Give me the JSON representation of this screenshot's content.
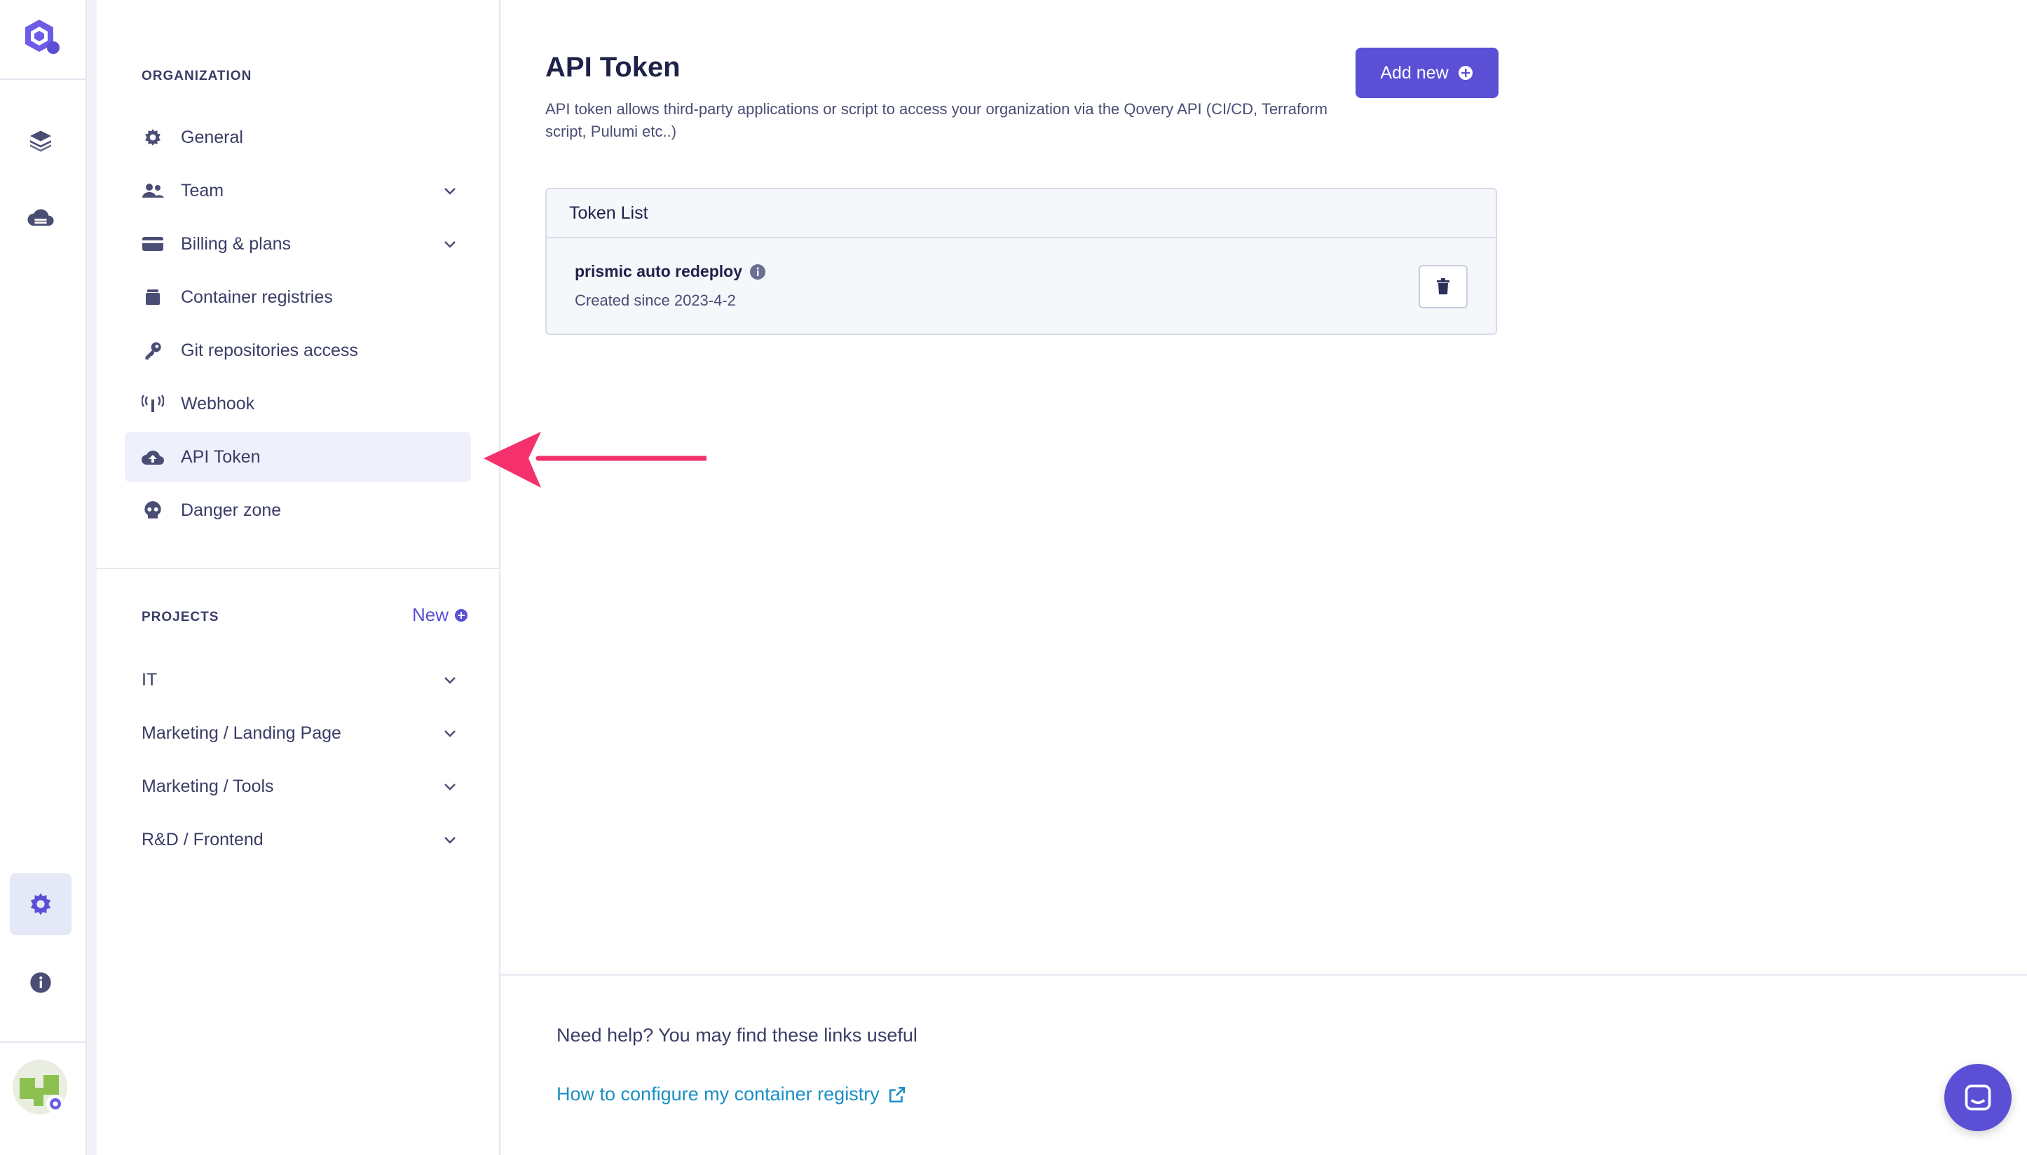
{
  "colors": {
    "accent": "#5b4fd6",
    "link": "#1a8fc4",
    "annotation_arrow": "#f4306d"
  },
  "rail": {
    "icons": [
      "qovery-logo-icon",
      "layers-icon",
      "cloud-server-icon",
      "settings-gear-icon",
      "info-icon"
    ],
    "active": "settings-gear-icon"
  },
  "sidebar": {
    "organization_title": "ORGANIZATION",
    "items": [
      {
        "label": "General",
        "icon": "gear-icon"
      },
      {
        "label": "Team",
        "icon": "users-icon"
      },
      {
        "label": "Billing & plans",
        "icon": "credit-card-icon"
      },
      {
        "label": "Container registries",
        "icon": "box-icon"
      },
      {
        "label": "Git repositories access",
        "icon": "key-icon"
      },
      {
        "label": "Webhook",
        "icon": "antenna-icon"
      },
      {
        "label": "API Token",
        "icon": "cloud-upload-icon"
      },
      {
        "label": "Danger zone",
        "icon": "skull-icon"
      }
    ],
    "active_item": "API Token",
    "projects_title": "PROJECTS",
    "new_label": "New",
    "projects": [
      {
        "label": "IT"
      },
      {
        "label": "Marketing / Landing Page"
      },
      {
        "label": "Marketing / Tools"
      },
      {
        "label": "R&D / Frontend"
      }
    ]
  },
  "main": {
    "title": "API Token",
    "description": "API token allows third-party applications or script to access your organization via the Qovery API (CI/CD, Terraform script, Pulumi etc..)",
    "add_button": "Add new",
    "token_list": {
      "header": "Token List",
      "tokens": [
        {
          "name": "prismic auto redeploy",
          "created": "Created since 2023-4-2"
        }
      ]
    }
  },
  "footer": {
    "help_text": "Need help? You may find these links useful",
    "link_text": "How to configure my container registry"
  }
}
